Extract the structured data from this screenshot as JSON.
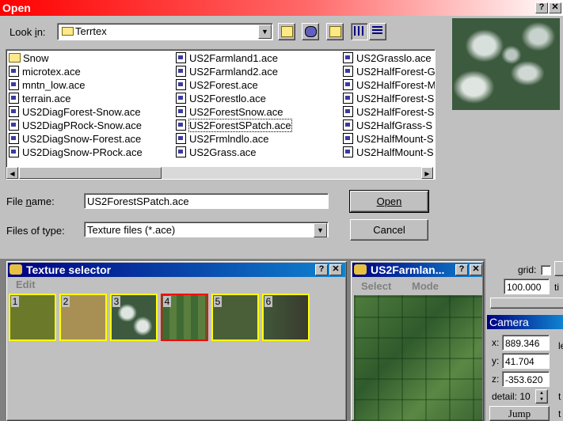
{
  "dialog": {
    "title": "Open",
    "title_buttons": {
      "help": "?",
      "close": "✕"
    },
    "look_in_label_pre": "Look ",
    "look_in_label_key": "i",
    "look_in_label_post": "n:",
    "look_in_value": "Terrtex",
    "columns": [
      [
        {
          "name": "Snow",
          "icon": "folder-icon"
        },
        {
          "name": "microtex.ace",
          "icon": "ace-file-icon"
        },
        {
          "name": "mntn_low.ace",
          "icon": "ace-file-icon"
        },
        {
          "name": "terrain.ace",
          "icon": "ace-file-icon"
        },
        {
          "name": "US2DiagForest-Snow.ace",
          "icon": "ace-file-icon"
        },
        {
          "name": "US2DiagPRock-Snow.ace",
          "icon": "ace-file-icon"
        },
        {
          "name": "US2DiagSnow-Forest.ace",
          "icon": "ace-file-icon"
        },
        {
          "name": "US2DiagSnow-PRock.ace",
          "icon": "ace-file-icon"
        }
      ],
      [
        {
          "name": "US2Farmland1.ace",
          "icon": "ace-file-icon"
        },
        {
          "name": "US2Farmland2.ace",
          "icon": "ace-file-icon"
        },
        {
          "name": "US2Forest.ace",
          "icon": "ace-file-icon"
        },
        {
          "name": "US2Forestlo.ace",
          "icon": "ace-file-icon"
        },
        {
          "name": "US2ForestSnow.ace",
          "icon": "ace-file-icon"
        },
        {
          "name": "US2ForestSPatch.ace",
          "icon": "ace-file-icon",
          "selected": true
        },
        {
          "name": "US2Frmlndlo.ace",
          "icon": "ace-file-icon"
        },
        {
          "name": "US2Grass.ace",
          "icon": "ace-file-icon"
        }
      ],
      [
        {
          "name": "US2Grasslo.ace",
          "icon": "ace-file-icon"
        },
        {
          "name": "US2HalfForest-G",
          "icon": "ace-file-icon"
        },
        {
          "name": "US2HalfForest-M",
          "icon": "ace-file-icon"
        },
        {
          "name": "US2HalfForest-S",
          "icon": "ace-file-icon"
        },
        {
          "name": "US2HalfForest-S",
          "icon": "ace-file-icon"
        },
        {
          "name": "US2HalfGrass-S",
          "icon": "ace-file-icon"
        },
        {
          "name": "US2HalfMount-S",
          "icon": "ace-file-icon"
        },
        {
          "name": "US2HalfMount-S",
          "icon": "ace-file-icon"
        }
      ]
    ],
    "file_name_label_pre": "File ",
    "file_name_label_key": "n",
    "file_name_label_post": "ame:",
    "file_name_value": "US2ForestSPatch.ace",
    "files_of_type_label": "Files of type:",
    "files_of_type_value": "Texture files (*.ace)",
    "open_label": "Open",
    "cancel_label": "Cancel"
  },
  "texture_selector": {
    "title": "Texture selector",
    "menu_edit": "Edit",
    "tiles": [
      "1",
      "2",
      "3",
      "4",
      "5",
      "6"
    ],
    "selected_tile": "4"
  },
  "preview_window": {
    "title": "US2Farmlan...",
    "menu_select": "Select",
    "menu_mode": "Mode"
  },
  "right_panel": {
    "grid_label": "grid:",
    "grid_value": "100.000",
    "camera_title": "Camera",
    "x_label": "x:",
    "x_value": "889.346",
    "y_label": "y:",
    "y_value": "41.704",
    "z_label": "z:",
    "z_value": "-353.620",
    "detail_label": "detail:",
    "detail_value": "10",
    "jump_label": "Jump"
  },
  "colors": {
    "dialog_title_start": "#ff0000",
    "child_title": "#000080",
    "tile_border": "#ffff00",
    "tile_selected_border": "#ff0000"
  }
}
